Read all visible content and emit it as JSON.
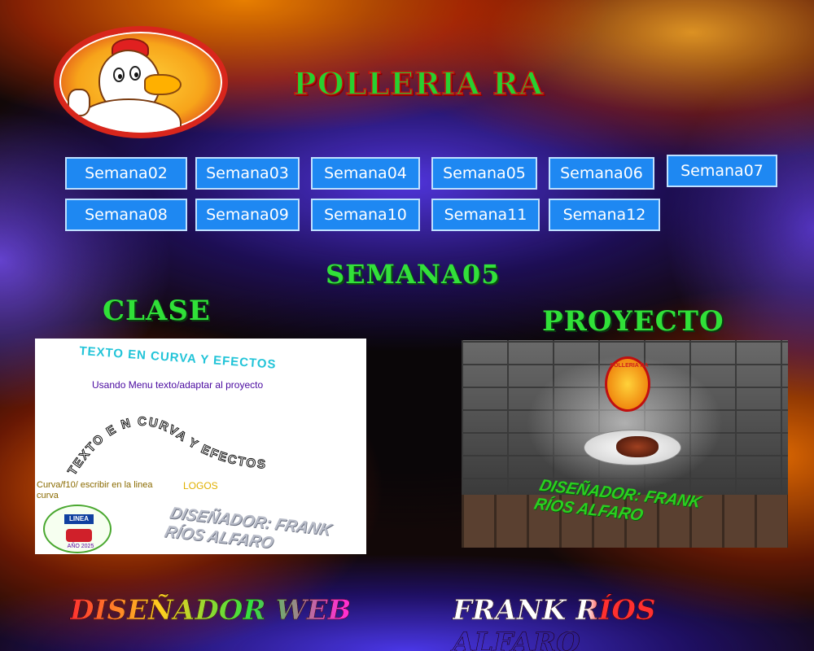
{
  "header": {
    "title": "POLLERIA RA"
  },
  "nav": {
    "row1": [
      "Semana02",
      "Semana03",
      "Semana04",
      "Semana05",
      "Semana06",
      "Semana07"
    ],
    "row2": [
      "Semana08",
      "Semana09",
      "Semana10",
      "Semana11",
      "Semana12"
    ]
  },
  "main": {
    "week_heading": "SEMANA05",
    "clase_heading": "CLASE",
    "proyecto_heading": "PROYECTO"
  },
  "clase": {
    "title": "TEXTO EN CURVA Y EFECTOS",
    "usando": "Usando Menu texto/adaptar al proyecto",
    "curve_text": "TEXTO E N CURVA Y EFECTOS",
    "curva_note": "Curva/f10/ escribir en la linea curva",
    "logos_label": "LOGOS",
    "badge_label": "LINEA",
    "badge_year": "AÑO 2025",
    "signature": "DISEÑADOR: FRANK RÍOS ALFARO"
  },
  "proyecto": {
    "logo_text": "POLLERIA RA",
    "signature": "DISEÑADOR: FRANK RÍOS ALFARO"
  },
  "footer": {
    "left": "DISEÑADOR WEB",
    "right": "FRANK RÍOS ALFARO"
  },
  "colors": {
    "nav_button": "#1e88f2",
    "heading_green": "#30e038",
    "title_red_stroke": "#c01010"
  }
}
